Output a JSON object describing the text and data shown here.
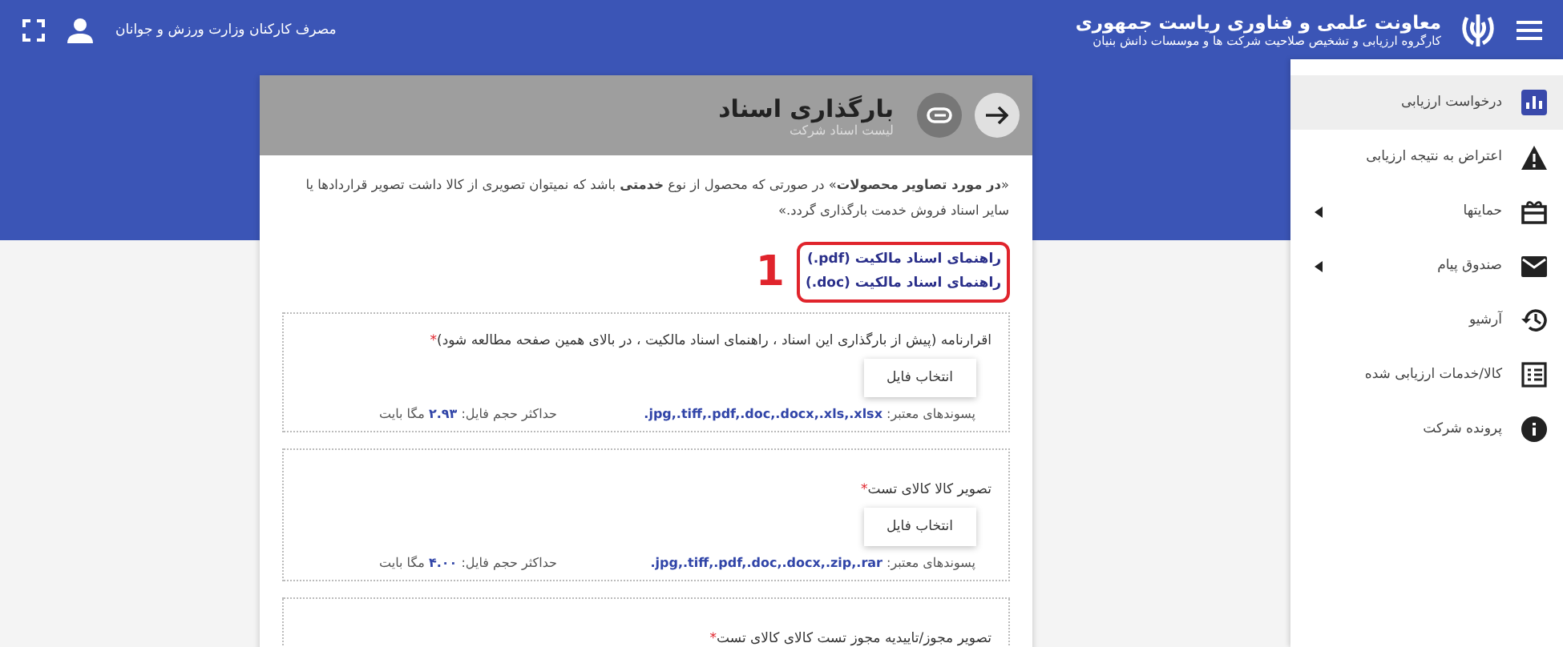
{
  "top_bar": {
    "title": "معاونت علمی و فناوری ریاست جمهوری",
    "subtitle": "کارگروه ارزیابی و تشخیص صلاحیت شرکت ها و موسسات دانش بنیان",
    "user_name": "مصرف کارکنان وزارت ورزش و جوانان"
  },
  "sidebar": {
    "items": [
      {
        "label": "درخواست ارزیابی",
        "selected": true,
        "has_submenu": false
      },
      {
        "label": "اعتراض به نتیجه ارزیابی",
        "selected": false,
        "has_submenu": false
      },
      {
        "label": "حمایتها",
        "selected": false,
        "has_submenu": true
      },
      {
        "label": "صندوق پیام",
        "selected": false,
        "has_submenu": true
      },
      {
        "label": "آرشیو",
        "selected": false,
        "has_submenu": false
      },
      {
        "label": "کالا/خدمات ارزیابی شده",
        "selected": false,
        "has_submenu": false
      },
      {
        "label": "پرونده شرکت",
        "selected": false,
        "has_submenu": false
      }
    ]
  },
  "card": {
    "title": "بارگذاری اسناد",
    "subtitle": "لیست اسناد شرکت",
    "note": "«**در مورد تصاویر محصولات**» در صورتی که محصول از نوع **خدمتی** باشد که نمیتوان تصویری از کالا داشت تصویر قراردادها یا سایر اسناد فروش خدمت بارگذاری گردد.»",
    "guide_links": [
      "راهنمای اسناد مالکیت (pdf.)",
      "راهنمای اسناد مالکیت (doc.)"
    ],
    "annotation": {
      "label": "1"
    },
    "uploads": [
      {
        "label": "اقرارنامه (پیش از بارگذاری این اسناد ، راهنمای اسناد مالکیت ، در بالای همین صفحه مطالعه شود)",
        "required_mark": "*",
        "button": "انتخاب فایل",
        "extensions_label": "پسوندهای معتبر:",
        "extensions": ".jpg,.tiff,.pdf,.doc,.docx,.xls,.xlsx",
        "max_size_label": "حداکثر حجم فایل:",
        "max_size": "۲.۹۳",
        "max_size_unit": "مگا بایت"
      },
      {
        "label": "تصویر کالا کالای تست",
        "required_mark": "*",
        "button": "انتخاب فایل",
        "extensions_label": "پسوندهای معتبر:",
        "extensions": ".jpg,.tiff,.pdf,.doc,.docx,.zip,.rar",
        "max_size_label": "حداکثر حجم فایل:",
        "max_size": "۴.۰۰",
        "max_size_unit": "مگا بایت"
      },
      {
        "label": "تصویر مجوز/تاییدیه مجوز تست کالای کالای تست",
        "required_mark": "*"
      }
    ]
  }
}
